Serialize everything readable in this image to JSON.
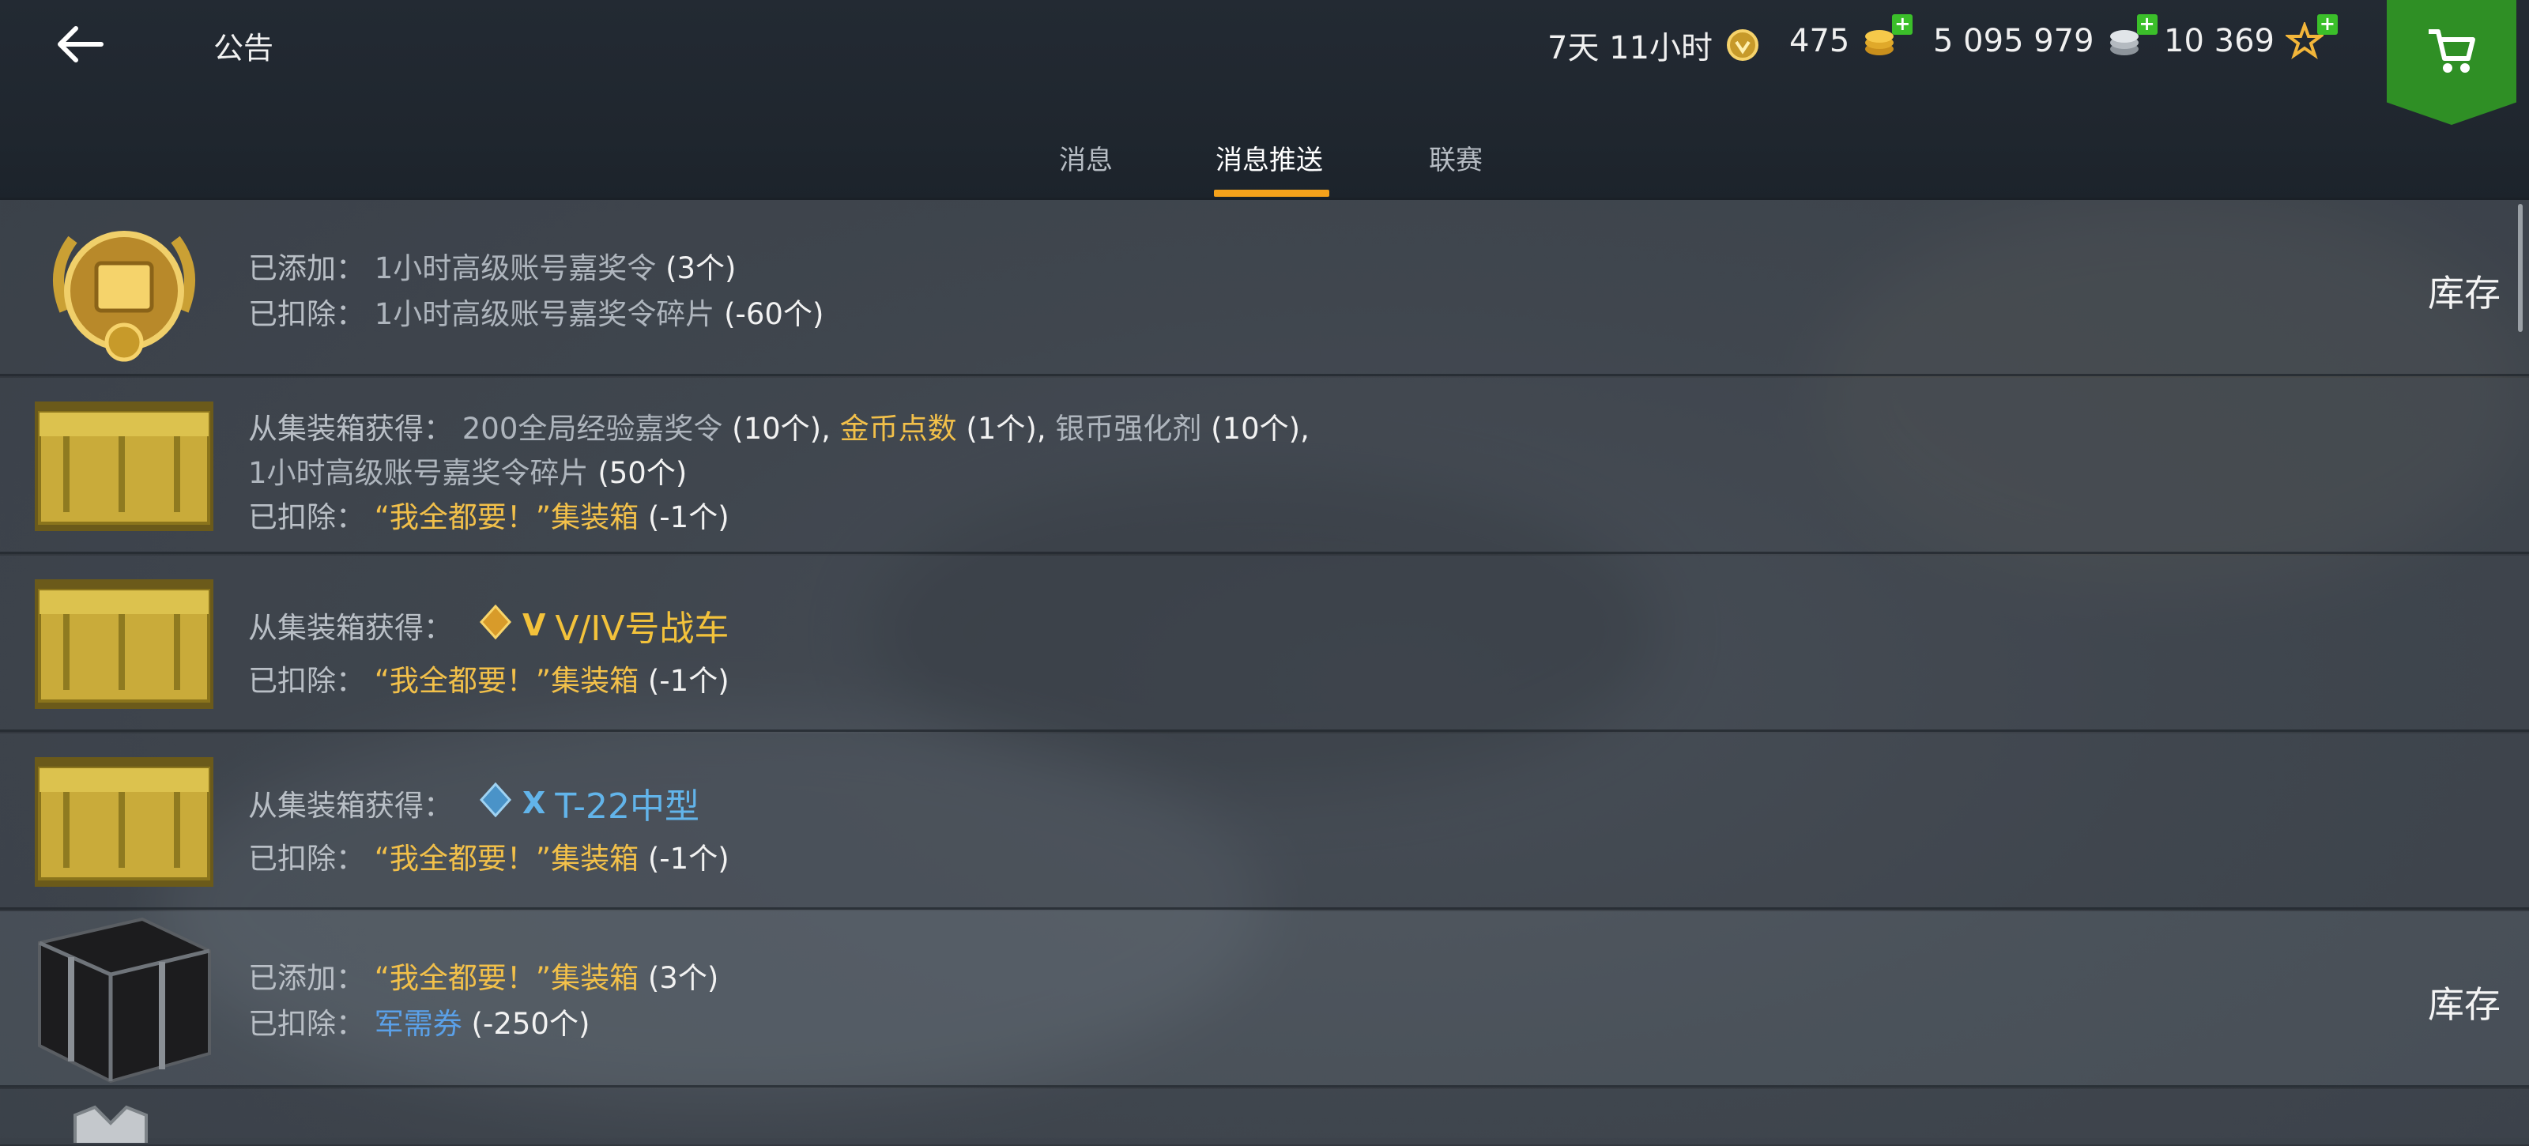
{
  "header": {
    "title": "公告",
    "premium_time": "7天 11小时",
    "gold": "475",
    "credits": "5 095 979",
    "free_xp": "10 369"
  },
  "tabs": [
    {
      "label": "消息"
    },
    {
      "label": "消息推送",
      "active": true
    },
    {
      "label": "联赛"
    }
  ],
  "rows": [
    {
      "line1": {
        "label": "已添加：",
        "item": "1小时高级账号嘉奖令",
        "count": "(3个)"
      },
      "line2": {
        "label": "已扣除：",
        "item": "1小时高级账号嘉奖令碎片",
        "count": "(-60个)"
      },
      "inventory_label": "库存"
    },
    {
      "line1": {
        "label": "从集装箱获得：",
        "item1": "200全局经验嘉奖令",
        "count1": "(10个)",
        "sep": ",",
        "item2": "金币点数",
        "count2": "(1个)",
        "item3": "银币强化剂",
        "count3": "(10个)"
      },
      "line2": {
        "item": "1小时高级账号嘉奖令碎片",
        "count": "(50个)"
      },
      "line3": {
        "label": "已扣除：",
        "item": "“我全都要！”集装箱",
        "count": "(-1个)"
      }
    },
    {
      "line1": {
        "label": "从集装箱获得：",
        "tier": "V",
        "tank": "V/IV号战车"
      },
      "line2": {
        "label": "已扣除：",
        "item": "“我全都要！”集装箱",
        "count": "(-1个)"
      }
    },
    {
      "line1": {
        "label": "从集装箱获得：",
        "tier": "X",
        "tank": "T-22中型"
      },
      "line2": {
        "label": "已扣除：",
        "item": "“我全都要！”集装箱",
        "count": "(-1个)"
      }
    },
    {
      "line1": {
        "label": "已添加：",
        "item": "“我全都要！”集装箱",
        "count": "(3个)"
      },
      "line2": {
        "label": "已扣除：",
        "item": "军需券",
        "count": "(-250个)"
      },
      "inventory_label": "库存"
    }
  ],
  "colors": {
    "accent_orange": "#f5a21b",
    "gold_text": "#f2c04a",
    "blue_text": "#5aa0e8",
    "cart_green": "#2f8f25"
  },
  "icons": [
    "back-arrow-icon",
    "premium-icon",
    "gold-coin-icon",
    "silver-coin-icon",
    "star-icon",
    "cart-icon"
  ]
}
